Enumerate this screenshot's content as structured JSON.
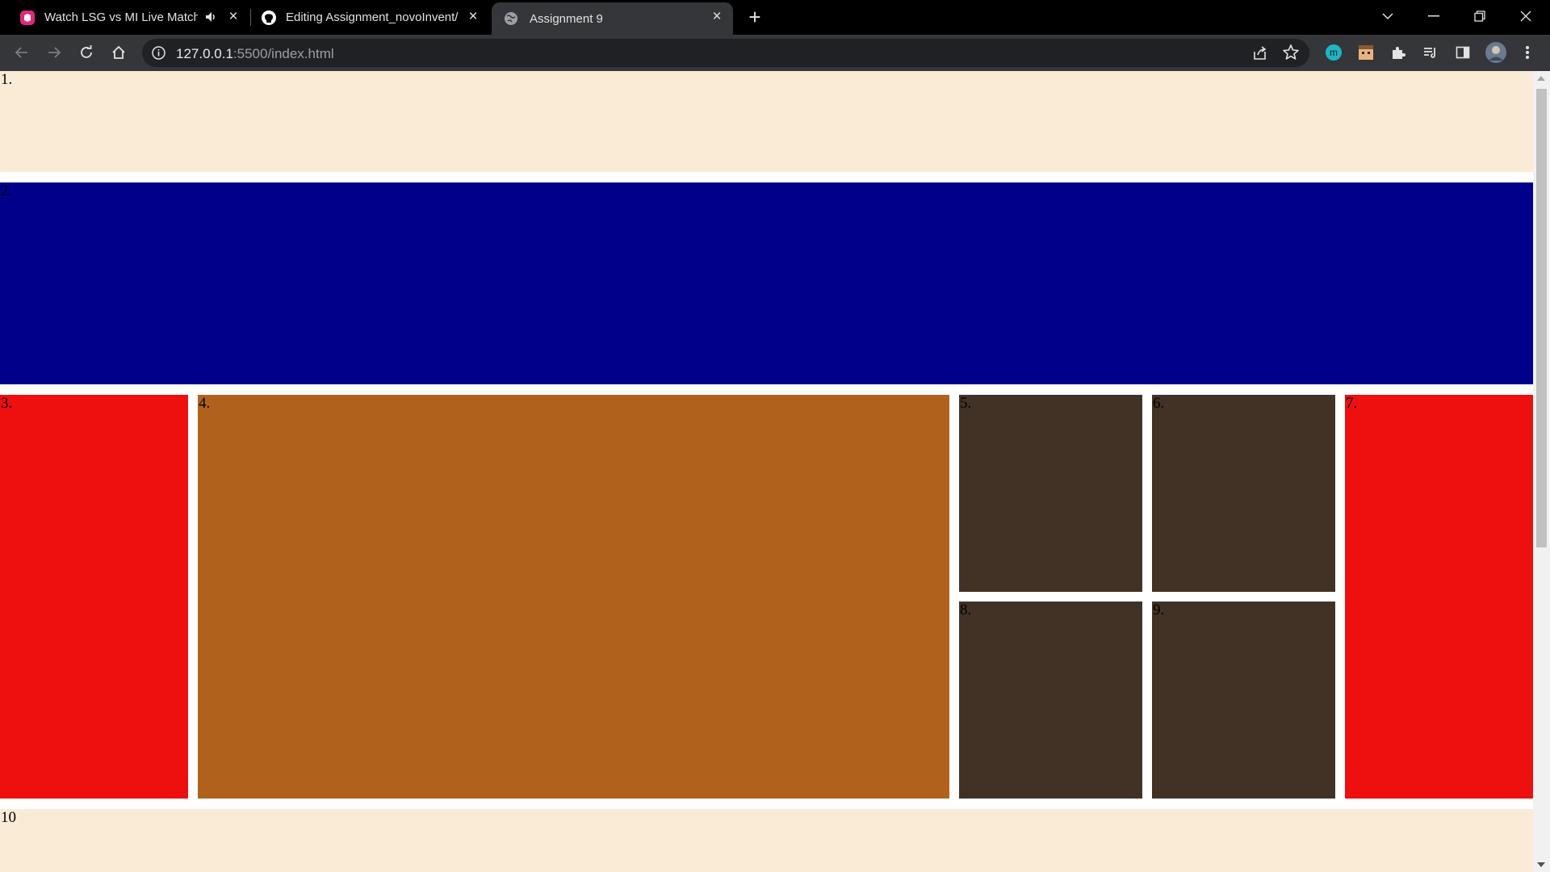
{
  "browser": {
    "tabs": [
      {
        "title": "Watch LSG vs MI Live Match",
        "favicon": "hotstar-icon",
        "audio": "speaker-muted-icon"
      },
      {
        "title": "Editing Assignment_novoInvent/",
        "favicon": "github-icon"
      },
      {
        "title": "Assignment 9",
        "favicon": "globe-icon",
        "active": true
      }
    ],
    "new_tab_label": "+",
    "address": {
      "host": "127.0.0.1",
      "rest": ":5500/index.html"
    }
  },
  "page": {
    "boxes": [
      {
        "label": "1.",
        "color": "#faebd7"
      },
      {
        "label": "2.",
        "color": "#00008b"
      },
      {
        "label": "3.",
        "color": "#ee0f0f"
      },
      {
        "label": "4.",
        "color": "#b0621c"
      },
      {
        "label": "5.",
        "color": "#413225"
      },
      {
        "label": "6.",
        "color": "#413225"
      },
      {
        "label": "7.",
        "color": "#ee0f0f"
      },
      {
        "label": "8.",
        "color": "#413225"
      },
      {
        "label": "9.",
        "color": "#413225"
      },
      {
        "label": "10",
        "color": "#faebd7"
      }
    ]
  }
}
